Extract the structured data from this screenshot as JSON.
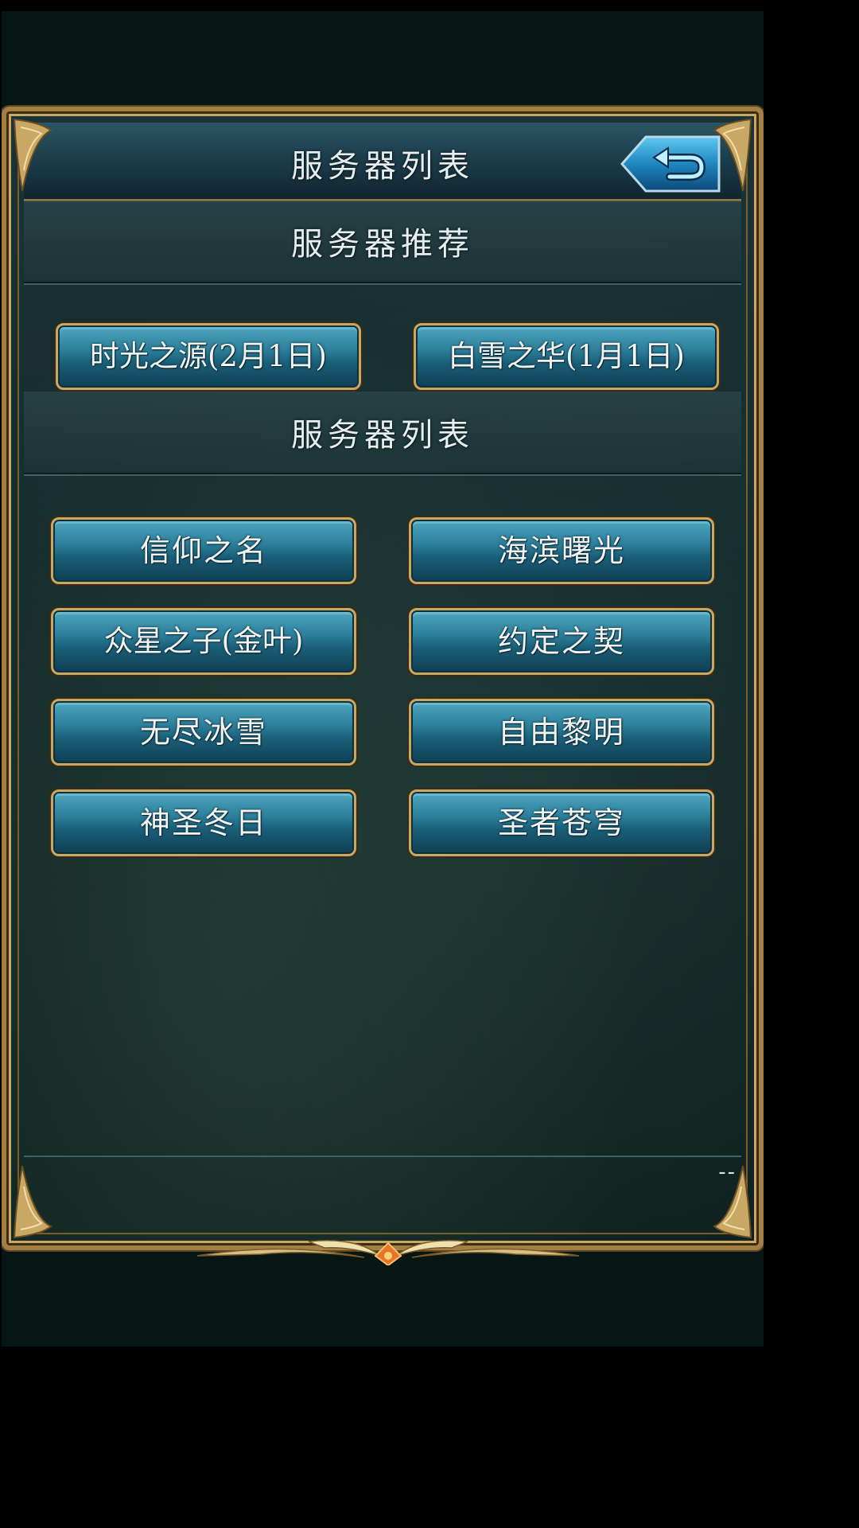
{
  "header": {
    "title": "服务器列表"
  },
  "recommended": {
    "title": "服务器推荐",
    "servers": [
      {
        "label": "时光之源(2月1日)"
      },
      {
        "label": "白雪之华(1月1日)"
      }
    ]
  },
  "server_list": {
    "title": "服务器列表",
    "servers": [
      {
        "label": "信仰之名"
      },
      {
        "label": "海滨曙光"
      },
      {
        "label": "众星之子(金叶)"
      },
      {
        "label": "约定之契"
      },
      {
        "label": "无尽冰雪"
      },
      {
        "label": "自由黎明"
      },
      {
        "label": "神圣冬日"
      },
      {
        "label": "圣者苍穹"
      }
    ]
  },
  "footer": {
    "label": "--"
  },
  "icons": {
    "back": "back-arrow-icon"
  },
  "colors": {
    "frame_gold": "#c9a765",
    "button_blue": "#2c7e9a",
    "panel_bg": "#142a2c",
    "back_button_blue": "#2aa0d8"
  }
}
